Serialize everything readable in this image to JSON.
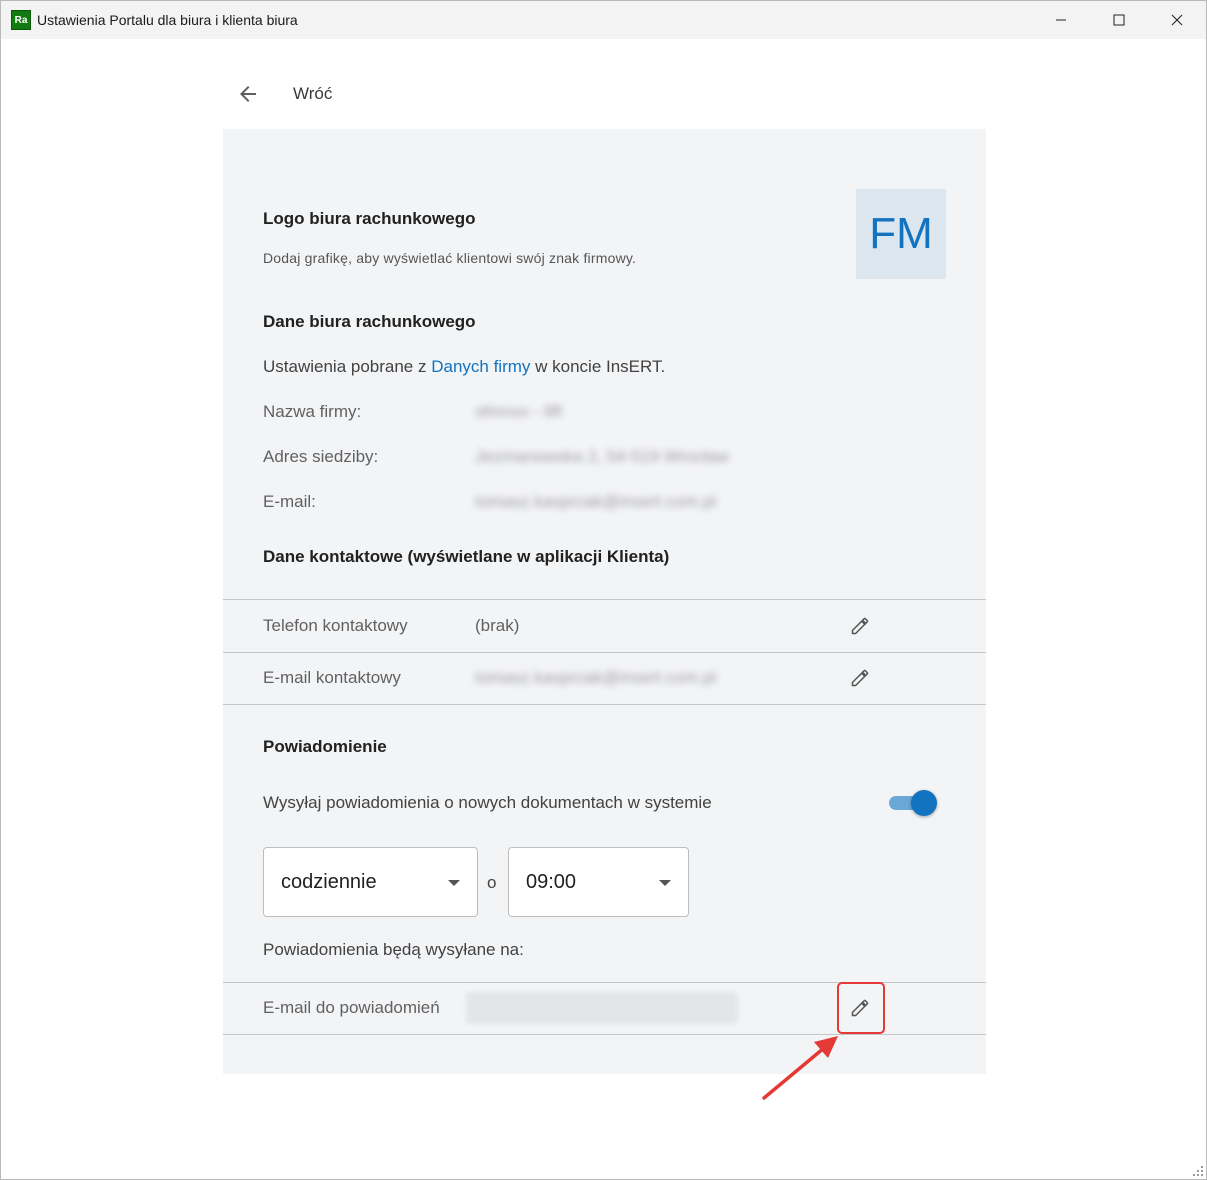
{
  "window": {
    "title": "Ustawienia Portalu dla biura i klienta biura",
    "app_icon_text": "Ra",
    "controls": [
      "minimize-icon",
      "maximize-icon",
      "close-icon"
    ]
  },
  "nav": {
    "back_label": "Wróć",
    "back_icon": "arrow-left-icon"
  },
  "logo_section": {
    "title": "Logo biura rachunkowego",
    "description": "Dodaj grafikę, aby wyświetlać klientowi swój znak firmowy.",
    "logo_initials": "FM"
  },
  "office_data": {
    "title": "Dane biura rachunkowego",
    "source_prefix": "Ustawienia pobrane z ",
    "source_link": "Danych firmy",
    "source_suffix": " w koncie InsERT.",
    "fields": [
      {
        "label": "Nazwa firmy:",
        "value": "sfmnxx - 8fl"
      },
      {
        "label": "Adres siedziby:",
        "value": "Jezmanowska 2, 54-519 Wrocław"
      },
      {
        "label": "E-mail:",
        "value": "tomasz.kasprzak@insert.com.pl"
      }
    ]
  },
  "contact": {
    "title": "Dane kontaktowe (wyświetlane w aplikacji Klienta)",
    "rows": [
      {
        "label": "Telefon kontaktowy",
        "value": "(brak)",
        "icon": "pencil-icon"
      },
      {
        "label": "E-mail kontaktowy",
        "value": "tomasz.kasprzak@insert.com.pl",
        "icon": "pencil-icon"
      }
    ]
  },
  "notifications": {
    "title": "Powiadomienie",
    "toggle_label": "Wysyłaj powiadomienia o nowych dokumentach w systemie",
    "toggle_on": true,
    "frequency": "codziennie",
    "at_label": "o",
    "time": "09:00",
    "recipients_label": "Powiadomienia będą wysyłane na:",
    "email_row": {
      "label": "E-mail do powiadomień",
      "icon": "pencil-icon"
    }
  },
  "colors": {
    "accent": "#1273c0",
    "panel_bg": "#f3f4f6",
    "annotation": "#e53935"
  }
}
